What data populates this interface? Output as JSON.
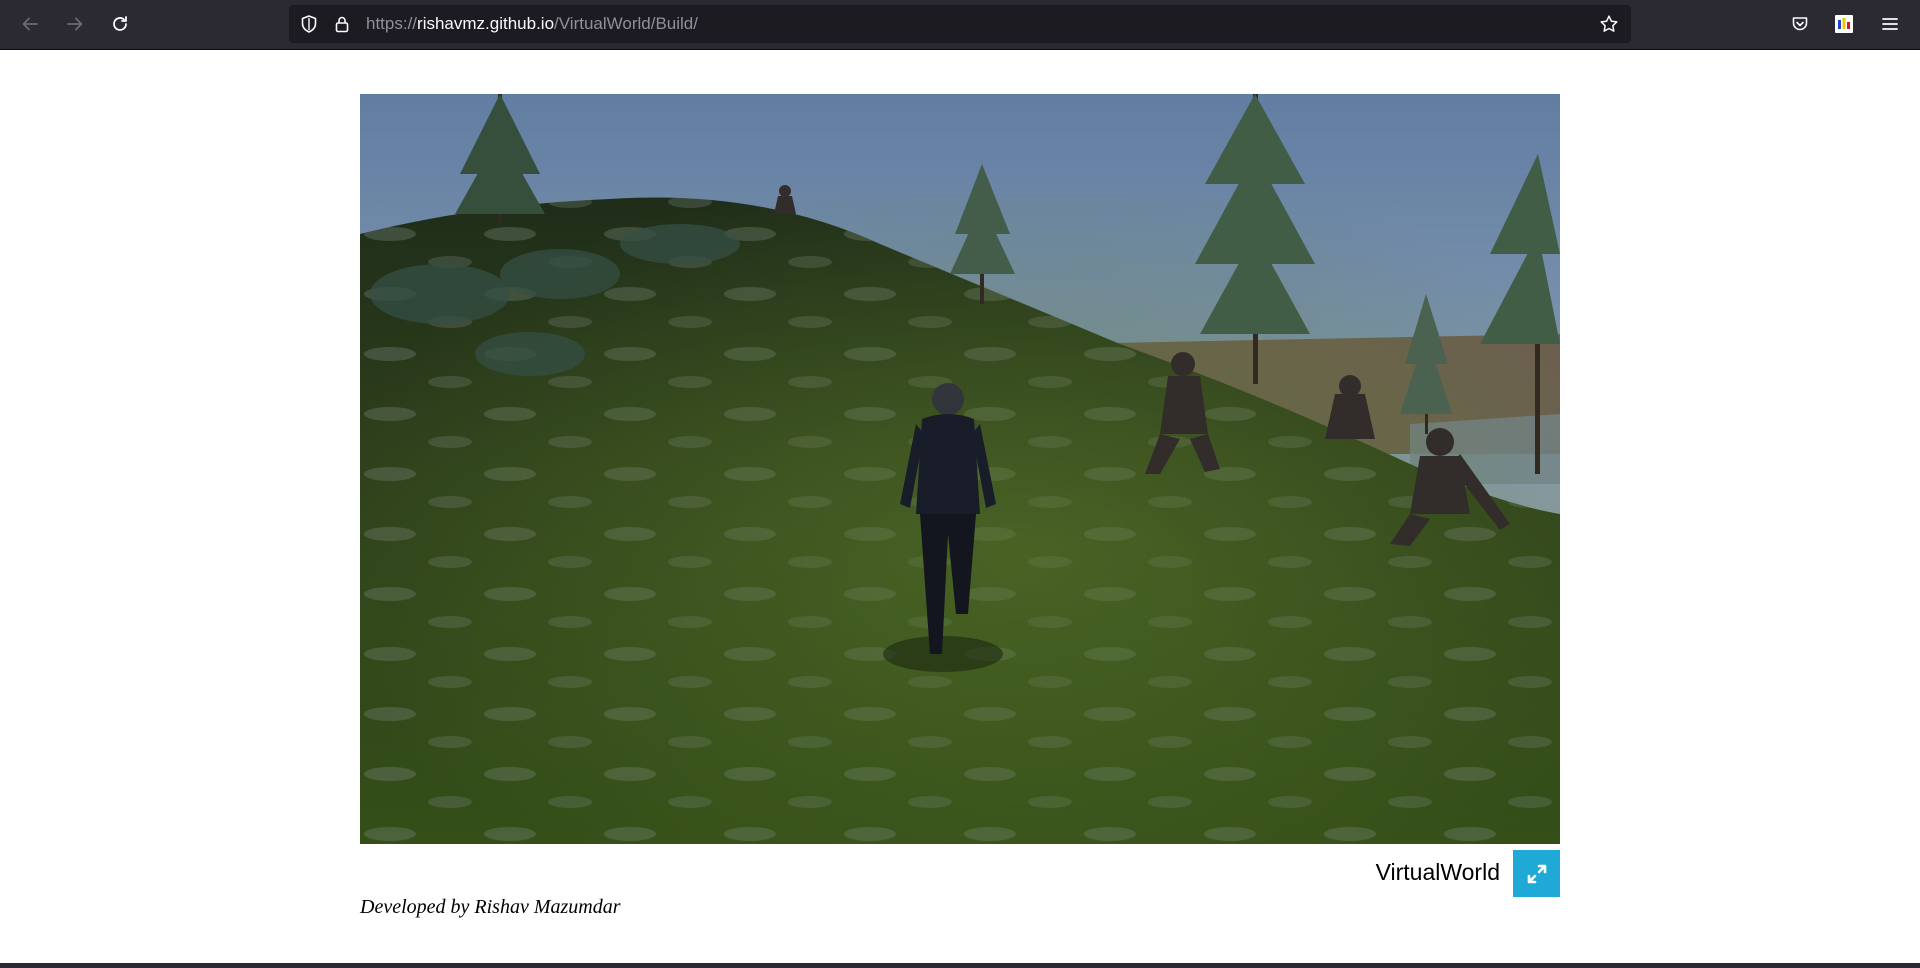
{
  "browser": {
    "url": {
      "scheme": "https://",
      "host": "rishavmz.github.io",
      "path": "/VirtualWorld/Build/"
    },
    "icons": {
      "back": "arrow-left-icon",
      "forward": "arrow-right-icon",
      "reload": "reload-icon",
      "tracking_protection": "shield-icon",
      "secure": "lock-icon",
      "bookmark": "star-icon",
      "pocket": "pocket-icon",
      "extension": "extension-icon",
      "menu": "hamburger-menu-icon"
    }
  },
  "game": {
    "description_icon": "unity-webgl-canvas",
    "title": "VirtualWorld",
    "fullscreen_icon": "fullscreen-icon",
    "accent_color": "#1fa9d6"
  },
  "credit": "Developed by Rishav Mazumdar",
  "colors": {
    "toolbar_bg": "#2b2a33",
    "urlbar_bg": "#1c1b22",
    "fullscreen_button_bg": "#1fa9d6"
  }
}
